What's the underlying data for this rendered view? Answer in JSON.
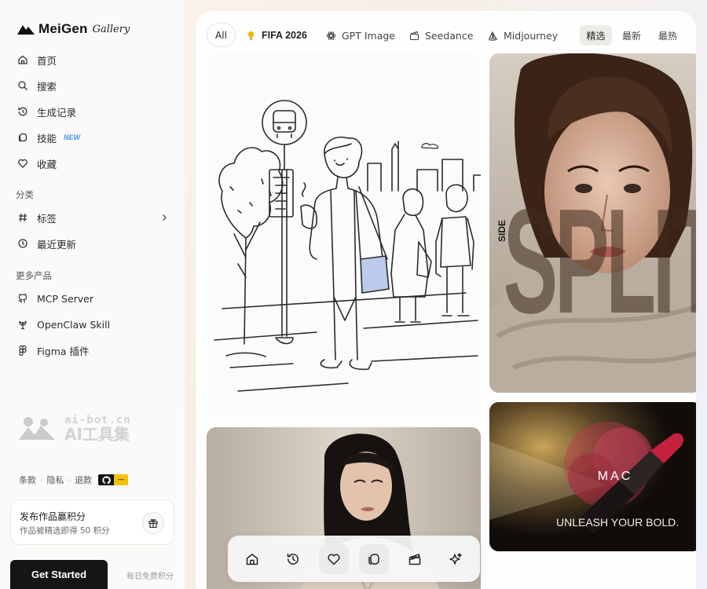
{
  "brand": {
    "name": "MeiGen",
    "script": "Gallery"
  },
  "nav": [
    {
      "label": "首页",
      "icon": "home-icon"
    },
    {
      "label": "搜索",
      "icon": "search-icon"
    },
    {
      "label": "生成记录",
      "icon": "history-icon"
    },
    {
      "label": "技能",
      "icon": "skill-icon",
      "badge": "NEW"
    },
    {
      "label": "收藏",
      "icon": "heart-icon"
    }
  ],
  "categories": {
    "label": "分类",
    "items": [
      {
        "label": "标签",
        "icon": "hash-icon"
      },
      {
        "label": "最近更新",
        "icon": "clock-icon"
      }
    ]
  },
  "more": {
    "label": "更多产品",
    "items": [
      {
        "label": "MCP Server",
        "icon": "github-icon"
      },
      {
        "label": "OpenClaw Skill",
        "icon": "claw-icon"
      },
      {
        "label": "Figma 插件",
        "icon": "figma-icon"
      }
    ]
  },
  "watermark": {
    "line1": "ai-bot.cn",
    "line2": "AI工具集"
  },
  "footer_links": [
    "条款",
    "隐私",
    "退款"
  ],
  "github_badge": "—",
  "promo": {
    "title": "发布作品赢积分",
    "subtitle": "作品被精选即得 50 积分"
  },
  "cta": {
    "label": "Get Started",
    "note": "每日免费积分"
  },
  "filters": {
    "all": "All",
    "items": [
      {
        "label": "FIFA 2026",
        "icon": "bulb-icon"
      },
      {
        "label": "GPT Image",
        "icon": "openai-icon"
      },
      {
        "label": "Seedance",
        "icon": "seedance-icon"
      },
      {
        "label": "Midjourney",
        "icon": "midjourney-icon"
      }
    ]
  },
  "sort": [
    {
      "label": "精选",
      "active": true
    },
    {
      "label": "最新",
      "active": false
    },
    {
      "label": "最热",
      "active": false
    }
  ],
  "gallery": {
    "poster_side_text": "SIDE",
    "poster_big_text": "SPLIT",
    "ad_brand": "MAC",
    "ad_tagline": "UNLEASH YOUR BOLD."
  },
  "dock": [
    "home-icon",
    "history-icon",
    "heart-icon",
    "skill-icon",
    "clapper-icon",
    "sparkle-icon"
  ],
  "colors": {
    "accent_new": "#4c8de8",
    "cta_bg": "#151515",
    "badge_yellow": "#f2c200"
  }
}
